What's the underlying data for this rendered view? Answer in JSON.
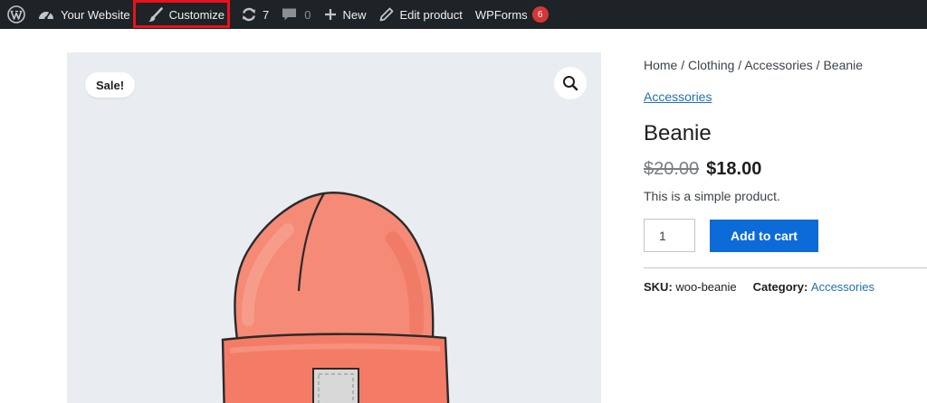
{
  "admin_bar": {
    "site_label": "Your Website",
    "customize_label": "Customize",
    "updates_count": "7",
    "comments_count": "0",
    "new_label": "New",
    "edit_label": "Edit product",
    "wpforms_label": "WPForms",
    "wpforms_badge": "6"
  },
  "gallery": {
    "sale_label": "Sale!",
    "image_icon": "beanie-illustration",
    "zoom_icon": "search-icon"
  },
  "breadcrumb": {
    "home": "Home",
    "sep1": " / ",
    "clothing": "Clothing",
    "sep2": " / ",
    "accessories": "Accessories",
    "sep3": " / ",
    "current": "Beanie"
  },
  "product": {
    "category_link": "Accessories",
    "title": "Beanie",
    "regular_price": "$20.00",
    "sale_price": "$18.00",
    "short_description": "This is a simple product.",
    "quantity": "1",
    "add_to_cart_label": "Add to cart",
    "sku_label": "SKU:",
    "sku_value": "woo-beanie",
    "category_label": "Category:",
    "category_value": "Accessories"
  },
  "colors": {
    "admin_bar_bg": "#1d2327",
    "highlight": "#e8121e",
    "button_blue": "#0c6bd8",
    "link_blue": "#2271b1",
    "badge_red": "#d63638",
    "gallery_bg": "#e9edf1"
  }
}
